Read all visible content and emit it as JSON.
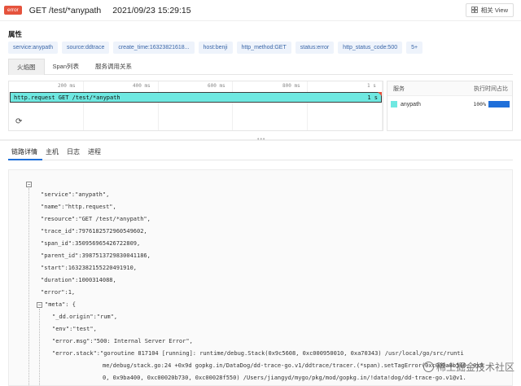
{
  "header": {
    "badge": "error",
    "title": "GET /test/*anypath",
    "time": "2021/09/23 15:29:15",
    "view_button": "相关 View"
  },
  "attributes": {
    "title": "属性",
    "tags": [
      "service:anypath",
      "source:ddtrace",
      "create_time:16323821618...",
      "host:benji",
      "http_method:GET",
      "status:error",
      "http_status_code:500",
      "5+"
    ]
  },
  "top_tabs": [
    "火焰图",
    "Span列表",
    "服务调用关系"
  ],
  "flame": {
    "ticks": [
      "200 ms",
      "400 ms",
      "600 ms",
      "800 ms",
      "1 s"
    ],
    "span_label": "http.request GET /test/*anypath",
    "span_duration": "1 s"
  },
  "services_panel": {
    "col_service": "服务",
    "col_ratio": "执行时间占比",
    "rows": [
      {
        "name": "anypath",
        "percent": "100%",
        "color": "#6ee8e1",
        "ratio": 1.0
      }
    ]
  },
  "bottom_tabs": [
    "链路详情",
    "主机",
    "日志",
    "进程"
  ],
  "json_lines": {
    "service": "\"service\":\"anypath\",",
    "name": "\"name\":\"http.request\",",
    "resource": "\"resource\":\"GET /test/*anypath\",",
    "trace_id": "\"trace_id\":7976182572960549602,",
    "span_id": "\"span_id\":350956965426722809,",
    "parent_id": "\"parent_id\":3987513729830041186,",
    "start": "\"start\":1632382155220491910,",
    "duration": "\"duration\":1000314088,",
    "error": "\"error\":1,",
    "meta": "\"meta\": {",
    "dd_origin": "\"_dd.origin\":\"rum\",",
    "env": "\"env\":\"test\",",
    "error_msg": "\"error.msg\":\"500: Internal Server Error\",",
    "error_stack_1": "\"error.stack\":\"goroutine 817104 [running]: runtime/debug.Stack(0x9c5608, 0xc000950010, 0xa70343) /usr/local/go/src/runti",
    "error_stack_2": "me/debug/stack.go:24 +0x9d gopkg.in/DataDog/dd-trace-go.v1/ddtrace/tracer.(*span).setTagError(0xc000a8b540, 0x9",
    "error_stack_3": "0, 0x9ba400, 0xc00020b730, 0xc00028f550) /Users/jiangyd/mygo/pkg/mod/gopkg.in/!data!dog/dd-trace-go.v1@v1."
  },
  "watermark": "稀土掘金技术社区"
}
